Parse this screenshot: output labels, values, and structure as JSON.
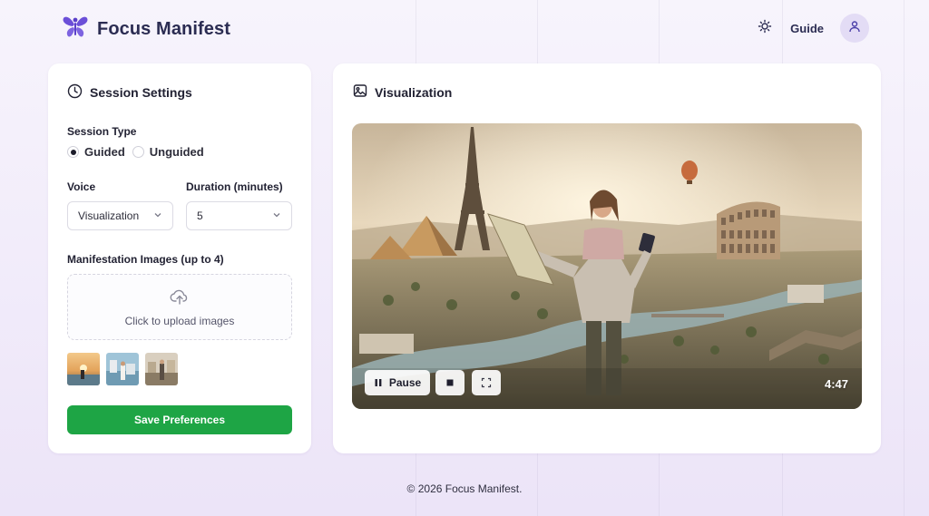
{
  "header": {
    "brand_name": "Focus Manifest",
    "guide_label": "Guide",
    "brand_color": "#6b4fd8"
  },
  "settings": {
    "title": "Session Settings",
    "session_type_label": "Session Type",
    "session_options": [
      {
        "label": "Guided",
        "selected": true
      },
      {
        "label": "Unguided",
        "selected": false
      }
    ],
    "voice_label": "Voice",
    "voice_value": "Visualization",
    "duration_label": "Duration (minutes)",
    "duration_value": "5",
    "images_label": "Manifestation Images (up to 4)",
    "upload_text": "Click to upload images",
    "thumbnail_count": 3,
    "save_label": "Save Preferences",
    "save_color": "#1ea545"
  },
  "visualization": {
    "title": "Visualization",
    "pause_label": "Pause",
    "timer": "4:47"
  },
  "footer": {
    "copyright": "© 2026 Focus Manifest."
  }
}
